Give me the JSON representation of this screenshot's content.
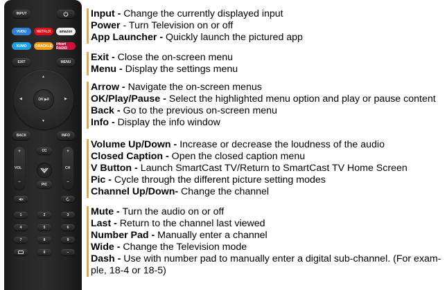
{
  "remote": {
    "input_label": "INPUT",
    "power_icon": "power-icon",
    "apps": [
      {
        "label": "VUDU",
        "color": "#2f7fd6",
        "text_color": "#ffffff"
      },
      {
        "label": "NETFLIX",
        "color": "#e50914",
        "text_color": "#ffffff"
      },
      {
        "label": "amazon",
        "color": "#f0f0f0",
        "text_color": "#111111"
      },
      {
        "label": "XUMO",
        "color": "#1ea0e0",
        "text_color": "#ffffff"
      },
      {
        "label": "CRACKLE",
        "color": "#f39c12",
        "text_color": "#ffffff"
      },
      {
        "label": "iHeart RADIO",
        "color": "#d0103a",
        "text_color": "#ffffff"
      }
    ],
    "exit_label": "EXIT",
    "menu_label": "MENU",
    "ok_label": "OK ▶II",
    "back_label": "BACK",
    "info_label": "INFO",
    "cc_label": "CC",
    "vol_label": "VOL",
    "ch_label": "CH",
    "pic_label": "PIC",
    "plus": "+",
    "minus": "–",
    "numbers": [
      "1",
      "2",
      "3",
      "4",
      "5",
      "6",
      "7",
      "8",
      "9"
    ],
    "zero_label": "0"
  },
  "descriptions": [
    {
      "name": "Input -",
      "text": " Change the currently displayed input"
    },
    {
      "name": "Power",
      "text": " - Turn Television on or off"
    },
    {
      "name": "App Launcher -",
      "text": " Quickly launch the pictured app"
    },
    {
      "name": "Exit -",
      "text": " Close the on-screen menu"
    },
    {
      "name": "Menu -",
      "text": " Display the settings menu"
    },
    {
      "name": "Arrow -",
      "text": " Navigate the on-screen menus"
    },
    {
      "name": "OK/Play/Pause -",
      "text": " Select the highlighted menu option and play or pause content"
    },
    {
      "name": "Back -",
      "text": " Go to the previous on-screen menu"
    },
    {
      "name": "Info -",
      "text": " Display the info window"
    },
    {
      "name": "Volume Up/Down -",
      "text": " Increase or decrease the loudness of the audio"
    },
    {
      "name": "Closed Caption -",
      "text": " Open the closed caption menu"
    },
    {
      "name": "V Button -",
      "text": " Launch SmartCast TV/Return to SmartCast TV Home Screen"
    },
    {
      "name": "Pic -",
      "text": " Cycle through the different picture setting modes"
    },
    {
      "name": "Channel Up/Down-",
      "text": " Change the channel"
    },
    {
      "name": "Mute -",
      "text": " Turn the audio on or off"
    },
    {
      "name": "Last -",
      "text": " Return to the channel last viewed"
    },
    {
      "name": "Number Pad -",
      "text": " Manually enter a channel"
    },
    {
      "name": "Wide -",
      "text": " Change the Television mode"
    },
    {
      "name": "Dash -",
      "text": " Use with number pad to manually enter a digital sub-channel. (For exam-ple, 18-4 or 18-5)"
    }
  ]
}
